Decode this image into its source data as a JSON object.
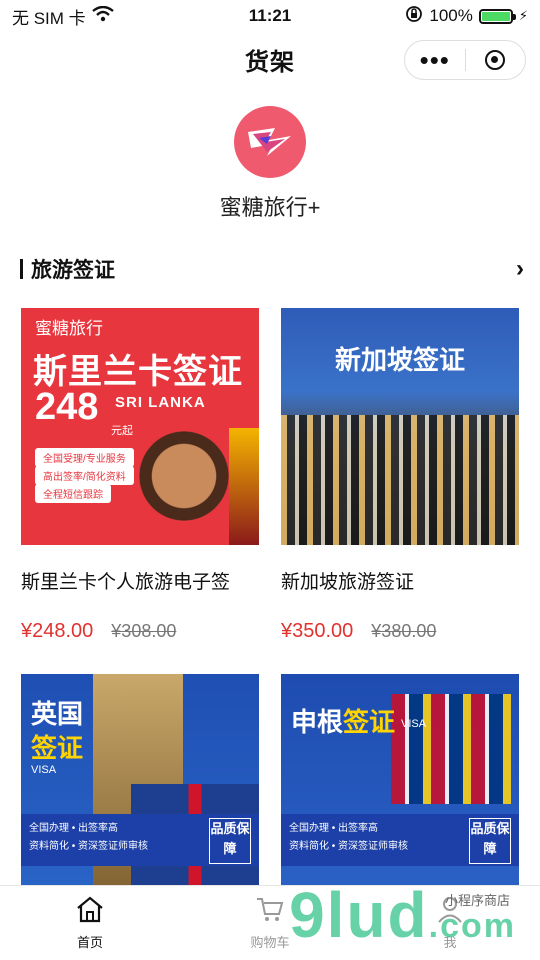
{
  "status_bar": {
    "carrier": "无 SIM 卡",
    "time": "11:21",
    "battery": "100%"
  },
  "navbar": {
    "title": "货架",
    "more_label": "•••"
  },
  "store": {
    "name": "蜜糖旅行+"
  },
  "section": {
    "title": "旅游签证"
  },
  "products": [
    {
      "name": "斯里兰卡个人旅游电子签",
      "price": "¥248.00",
      "original_price": "¥308.00",
      "image": {
        "brand": "蜜糖旅行",
        "headline": "斯里兰卡签证",
        "big_number": "248",
        "suffix": "元起",
        "sub": "SRI LANKA",
        "pills": [
          "全国受理/专业服务",
          "高出签率/简化资料",
          "全程短信跟踪"
        ]
      }
    },
    {
      "name": "新加坡旅游签证",
      "price": "¥350.00",
      "original_price": "¥380.00",
      "image": {
        "headline": "新加坡签证"
      }
    },
    {
      "image": {
        "line1": "英国",
        "line2": "签证",
        "visa": "VISA",
        "features": [
          "全国办理 • 出签率高",
          "资料简化 • 资深签证师审核"
        ],
        "quality": "品质保障"
      }
    },
    {
      "image": {
        "line1": "申根",
        "line2": "签证",
        "visa": "VISA",
        "features": [
          "全国办理 • 出签率高",
          "资料简化 • 资深签证师审核"
        ],
        "quality": "品质保障"
      }
    }
  ],
  "tabbar": {
    "tabs": [
      {
        "label": "首页",
        "icon": "home-icon"
      },
      {
        "label": "购物车",
        "icon": "cart-icon"
      },
      {
        "label": "我",
        "icon": "user-icon"
      }
    ]
  },
  "watermark": {
    "text": "9lud",
    "suffix": ".com",
    "small": "小程序商店"
  }
}
